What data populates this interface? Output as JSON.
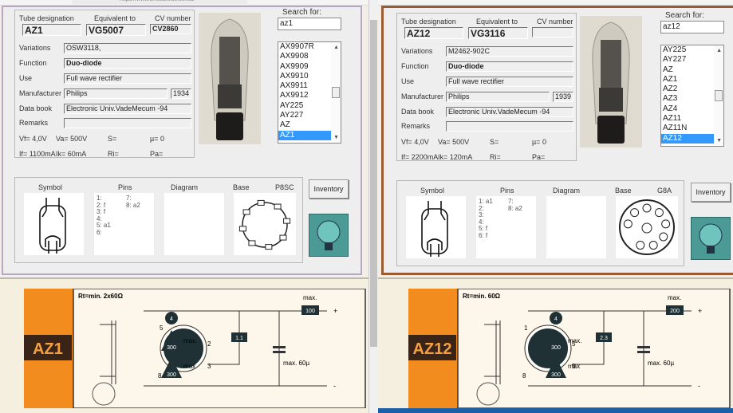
{
  "browser": {
    "url": "https://www.smsebwise.se/tub"
  },
  "panes": [
    {
      "labels": {
        "tube_designation": "Tube designation",
        "equivalent_to": "Equivalent to",
        "cv_number": "CV number",
        "variations": "Variations",
        "function": "Function",
        "use": "Use",
        "manufacturer": "Manufacturer",
        "data_book": "Data book",
        "remarks": "Remarks",
        "search_for": "Search for:",
        "symbol": "Symbol",
        "pins": "Pins",
        "diagram": "Diagram",
        "base": "Base",
        "inventory": "Inventory"
      },
      "tube": "AZ1",
      "equivalent": "VG5007",
      "cv": "CV2860",
      "variations": "OSW3118,",
      "function": "Duo-diode",
      "use": "Full wave rectifier",
      "manufacturer": "Philips",
      "year": "1934",
      "data_book": "Electronic Univ.VadeMecum -94",
      "remarks": "",
      "params": {
        "vf": "Vf= 4,0V",
        "va": "Va= 500V",
        "s": "S=",
        "mu": "µ=  0",
        "if": "If= 1100mA",
        "ik": "Ik=  60mA",
        "ri": "Ri=",
        "pa": "Pa="
      },
      "search": "az1",
      "list": [
        "AX9907R",
        "AX9908",
        "AX9909",
        "AX9910",
        "AX9911",
        "AX9912",
        "AY225",
        "AY227",
        "AZ",
        "AZ1"
      ],
      "selected": "AZ1",
      "pins_col1": [
        "1:",
        "2: f",
        "3: f",
        "4:",
        "5: a1",
        "6:"
      ],
      "pins_col2": [
        "7:",
        "8: a2"
      ],
      "base_type": "P8SC",
      "circuit": {
        "name": "AZ1",
        "rt": "Rt=min. 2x60Ω",
        "max_label": "max.",
        "out_current": "100",
        "ratio": "1.1",
        "v1": "300",
        "v2": "300",
        "max1": "max.",
        "max2": "max",
        "cap": "max. 60µ",
        "heater": "4",
        "pin_a": "5",
        "pin_b": "2",
        "pin_c": "3",
        "pin_d": "8",
        "plus": "+",
        "minus": "-"
      }
    },
    {
      "labels": {
        "tube_designation": "Tube designation",
        "equivalent_to": "Equivalent to",
        "cv_number": "CV number",
        "variations": "Variations",
        "function": "Function",
        "use": "Use",
        "manufacturer": "Manufacturer",
        "data_book": "Data book",
        "remarks": "Remarks",
        "search_for": "Search for:",
        "symbol": "Symbol",
        "pins": "Pins",
        "diagram": "Diagram",
        "base": "Base",
        "inventory": "Inventory"
      },
      "tube": "AZ12",
      "equivalent": "VG3116",
      "cv": "",
      "variations": "M2462-902C",
      "function": "Duo-diode",
      "use": "Full wave rectifier",
      "manufacturer": "Philips",
      "year": "1939",
      "data_book": "Electronic Univ.VadeMecum -94",
      "remarks": "",
      "params": {
        "vf": "Vf= 4,0V",
        "va": "Va= 500V",
        "s": "S=",
        "mu": "µ=  0",
        "if": "If= 2200mA",
        "ik": "Ik=  120mA",
        "ri": "Ri=",
        "pa": "Pa="
      },
      "search": "az12",
      "list": [
        "AY225",
        "AY227",
        "AZ",
        "AZ1",
        "AZ2",
        "AZ3",
        "AZ4",
        "AZ11",
        "AZ11N",
        "AZ12"
      ],
      "selected": "AZ12",
      "pins_col1": [
        "1: a1",
        "2:",
        "3:",
        "4:",
        "5: f",
        "6: f"
      ],
      "pins_col2": [
        "7:",
        "8: a2"
      ],
      "base_type": "G8A",
      "circuit": {
        "name": "AZ12",
        "rt": "Rt=min. 60Ω",
        "max_label": "max.",
        "out_current": "200",
        "ratio": "2.3",
        "v1": "300",
        "v2": "300",
        "max1": "max.",
        "max2": "max",
        "cap": "max. 60µ",
        "heater": "4",
        "pin_a": "1",
        "pin_b": "5",
        "pin_c": "6",
        "pin_d": "8",
        "plus": "+",
        "minus": "-"
      }
    }
  ],
  "colors": {
    "selection": "#3399ff",
    "orange": "#f28c1e",
    "taskbar": "#1a5fa8"
  }
}
